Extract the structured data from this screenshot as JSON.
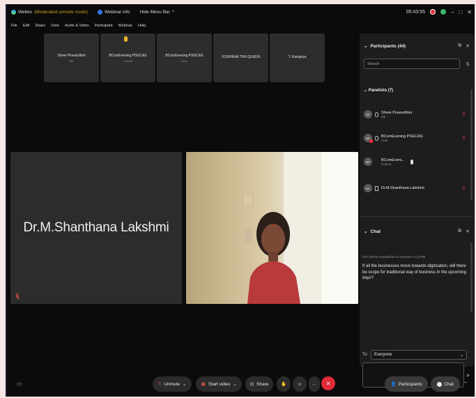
{
  "titlebar": {
    "app_name": "Webex",
    "mode": "(Moderated unmute mode)",
    "webinar_info": "Webinar info",
    "hide_menu_bar": "Hide Menu Bar",
    "time": "05:43:55",
    "minimize": "–",
    "maximize": "□",
    "close": "✕"
  },
  "menubar": [
    "File",
    "Edit",
    "Share",
    "View",
    "Audio & Video",
    "Participant",
    "Webinar",
    "Help"
  ],
  "thumbnails": [
    {
      "name": "Shree Pravardhini",
      "role": "Me",
      "hand": false
    },
    {
      "name": "BComEvening PSGCAS",
      "role": "Cohost",
      "hand": true
    },
    {
      "name": "BComEvening PSGCAS",
      "role": "Host",
      "hand": false
    },
    {
      "name": "JOSHIKAA THE QUEEN",
      "role": "",
      "hand": false
    },
    {
      "name": "T. Kavipriya",
      "role": "",
      "hand": false
    }
  ],
  "main_tile": {
    "name": "Dr.M.Shanthana Lakshmi"
  },
  "participants_panel": {
    "title": "Participants (44)",
    "search_placeholder": "Search",
    "panelists_header": "Panelists (7)",
    "panelists": [
      {
        "initials": "SP",
        "name": "Shree Pravardhini",
        "role": "Me",
        "muted": true
      },
      {
        "initials": "BP",
        "name": "BComEvening PSGCAS",
        "role": "Host",
        "muted": true
      },
      {
        "initials": "BP",
        "name": "BComEveni...",
        "role": "Cohost",
        "muted": false
      },
      {
        "initials": "DL",
        "name": "Dr.M.Shanthana Lakshmi",
        "role": "",
        "muted": true
      }
    ]
  },
  "chat_panel": {
    "title": "Chat",
    "meta": "from Shree Pravardhini to everyone:   5:14 PM",
    "message": "If all the businesses move towards digitisation, will there be scope for traditional way of business in the upcoming days?",
    "to_label": "To:",
    "to_value": "Everyone"
  },
  "bottom_bar": {
    "unmute": "Unmute",
    "start_video": "Start video",
    "share": "Share",
    "participants": "Participants",
    "chat": "Chat"
  },
  "colors": {
    "background": "#0b0b0b",
    "leave_red": "#e22c3a",
    "panel": "#1d1d1d"
  }
}
